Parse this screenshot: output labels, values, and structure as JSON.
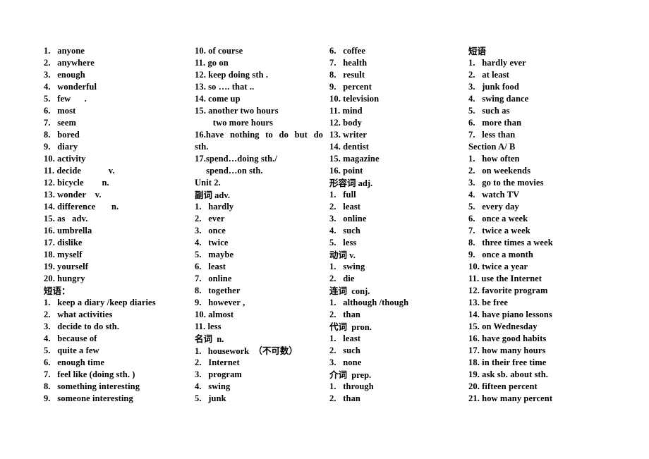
{
  "document": {
    "type": "vocabulary-word-list",
    "language": "English-Chinese",
    "columns": [
      {
        "id": "column-1",
        "lines": [
          "1.   anyone",
          "2.   anywhere",
          "3.   enough",
          "4.   wonderful",
          "5.   few      .",
          "6.   most",
          "7.   seem",
          "8.   bored",
          "9.   diary",
          "10. activity",
          "11. decide            v.",
          "12. bicycle        n.",
          "13. wonder    v.",
          "14. difference       n.",
          "15. as   adv.",
          "16. umbrella",
          "17. dislike",
          "18. myself",
          "19. yourself",
          "20. hungry",
          "短语：",
          "1.   keep a diary /keep diaries",
          "2.   what activities",
          "3.   decide to do sth.",
          "4.   because of",
          "5.   quite a few",
          "6.   enough time",
          "7.   feel like (doing sth. )",
          "8.   something interesting",
          "9.   someone interesting"
        ]
      },
      {
        "id": "column-2",
        "lines": [
          "10. of course",
          "11. go on",
          "12. keep doing sth .",
          "13. so …. that ..",
          "14. come up",
          "15. another two hours",
          "        two more hours",
          "16.have nothing to do but do",
          "sth.",
          "17.spend…doing sth./",
          "     spend…on sth.",
          "Unit 2.",
          "副词 adv.",
          "1.   hardly",
          "2.   ever",
          "3.   once",
          "4.   twice",
          "5.   maybe",
          "6.   least",
          "7.   online",
          "8.   together",
          "9.   however ,",
          "10. almost",
          "11. less",
          "名词  n.",
          "1.   housework  （不可数）",
          "2.   Internet",
          "3.   program",
          "4.   swing",
          "5.   junk"
        ],
        "justified_line_index": 7
      },
      {
        "id": "column-3",
        "lines": [
          "6.   coffee",
          "7.   health",
          "8.   result",
          "9.   percent",
          "10. television",
          "11. mind",
          "12. body",
          "13. writer",
          "14. dentist",
          "15. magazine",
          "16. point",
          "形容词 adj.",
          "1.   full",
          "2.   least",
          "3.   online",
          "4.   such",
          "5.   less",
          "动词 v.",
          "1.   swing",
          "2.   die",
          "连词  conj.",
          "1.   although /though",
          "2.   than",
          "代词  pron.",
          "1.   least",
          "2.   such",
          "3.   none",
          "介词  prep.",
          "1.   through",
          "2.   than"
        ]
      },
      {
        "id": "column-4",
        "lines": [
          "短语",
          "1.   hardly ever",
          "2.   at least",
          "3.   junk food",
          "4.   swing dance",
          "5.   such as",
          "6.   more than",
          "7.   less than",
          "Section A/ B",
          "1.   how often",
          "2.   on weekends",
          "3.   go to the movies",
          "4.   watch TV",
          "5.   every day",
          "6.   once a week",
          "7.   twice a week",
          "8.   three times a week",
          "9.   once a month",
          "10. twice a year",
          "11. use the Internet",
          "12. favorite program",
          "13. be free",
          "14. have piano lessons",
          "15. on Wednesday",
          "16. have good habits",
          "17. how many hours",
          "18. in their free time",
          "19. ask sb. about sth.",
          "20. fifteen percent",
          "21. how many percent"
        ]
      }
    ]
  }
}
